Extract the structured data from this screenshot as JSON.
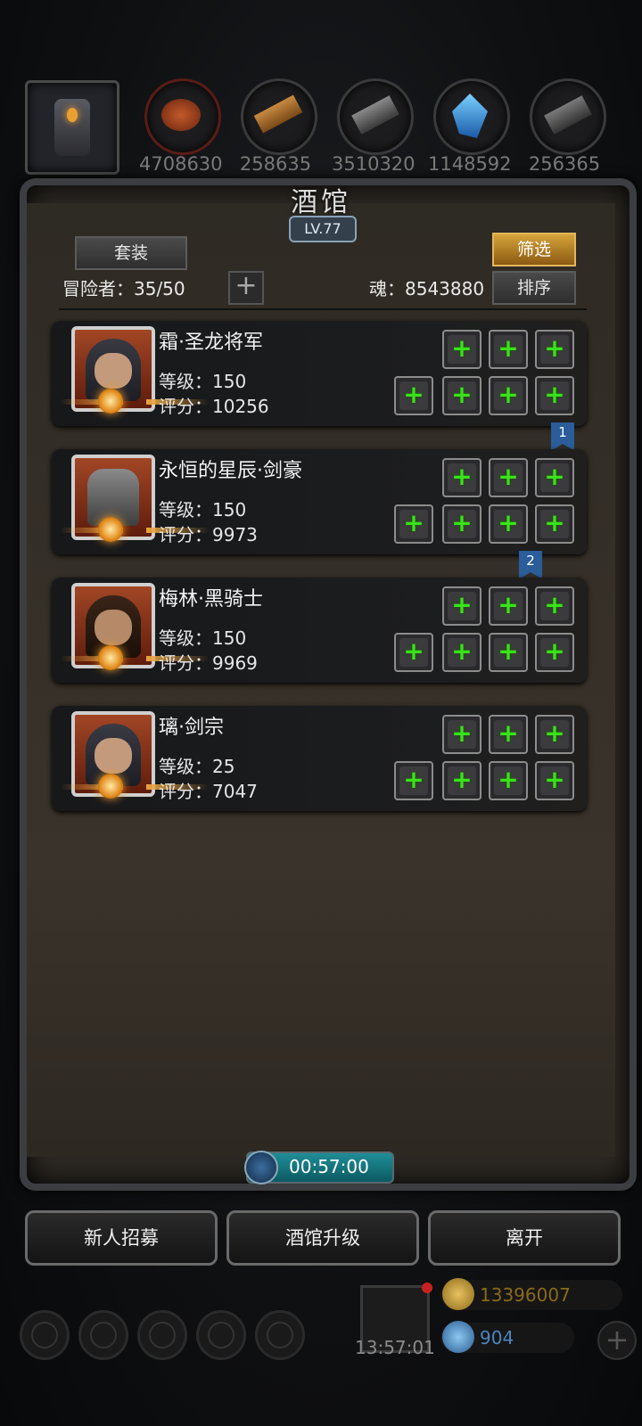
{
  "resources": [
    {
      "name": "hero-portrait-icon",
      "count": ""
    },
    {
      "name": "meat-icon",
      "count": "4708630"
    },
    {
      "name": "wood-icon",
      "count": "258635"
    },
    {
      "name": "iron-icon",
      "count": "3510320"
    },
    {
      "name": "crystal-icon",
      "count": "1148592"
    },
    {
      "name": "stone-icon",
      "count": "256365"
    }
  ],
  "panel": {
    "title": "酒馆",
    "level": "LV.77",
    "set_button": "套装",
    "filter_button": "筛选",
    "sort_button": "排序",
    "adventurers_label": "冒险者：35/50",
    "soul_label": "魂：8543880"
  },
  "heroes": [
    {
      "name": "霜·圣龙将军",
      "level": "等级：150",
      "score": "评分：10256",
      "bookmark": ""
    },
    {
      "name": "永恒的星辰·剑豪",
      "level": "等级：150",
      "score": "评分：9973",
      "bookmark": "1"
    },
    {
      "name": "梅林·黑骑士",
      "level": "等级：150",
      "score": "评分：9969",
      "bookmark": "2"
    },
    {
      "name": "璃·剑宗",
      "level": "等级：25",
      "score": "评分：7047",
      "bookmark": ""
    }
  ],
  "timer": "00:57:00",
  "actions": {
    "recruit": "新人招募",
    "upgrade": "酒馆升级",
    "leave": "离开"
  },
  "footer": {
    "gift_time": "13:57:01",
    "gold": "13396007",
    "gems": "904",
    "gold_color": "#8a6a1a",
    "gem_color": "#4a86c0"
  }
}
